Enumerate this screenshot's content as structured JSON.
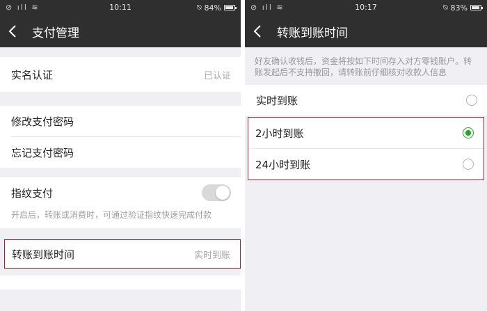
{
  "left": {
    "status": {
      "signal": "⊘ ıll ≋",
      "time": "10:11",
      "battery": "84%"
    },
    "title": "支付管理",
    "items": {
      "realname": {
        "label": "实名认证",
        "value": "已认证"
      },
      "change_pw": {
        "label": "修改支付密码"
      },
      "forgot_pw": {
        "label": "忘记支付密码"
      },
      "fingerprint": {
        "label": "指纹支付",
        "hint": "开启后，转账或消费时，可通过验证指纹快速完成付款",
        "enabled": false
      },
      "transfer_time": {
        "label": "转账到账时间",
        "value": "实时到账"
      }
    }
  },
  "right": {
    "status": {
      "signal": "⊘ ıll ≋",
      "time": "10:17",
      "battery": "83%"
    },
    "title": "转账到账时间",
    "notice": "好友确认收钱后，资金将按如下时间存入对方零钱账户。转账发起后不支持撤回，请转账前仔细核对收款人信息",
    "options": [
      {
        "label": "实时到账",
        "selected": false
      },
      {
        "label": "2小时到账",
        "selected": true
      },
      {
        "label": "24小时到账",
        "selected": false
      }
    ]
  },
  "colors": {
    "navbar": "#2f2f2f",
    "accent_green": "#1aad19",
    "highlight_border": "#a3232a",
    "background": "#efeff4"
  }
}
